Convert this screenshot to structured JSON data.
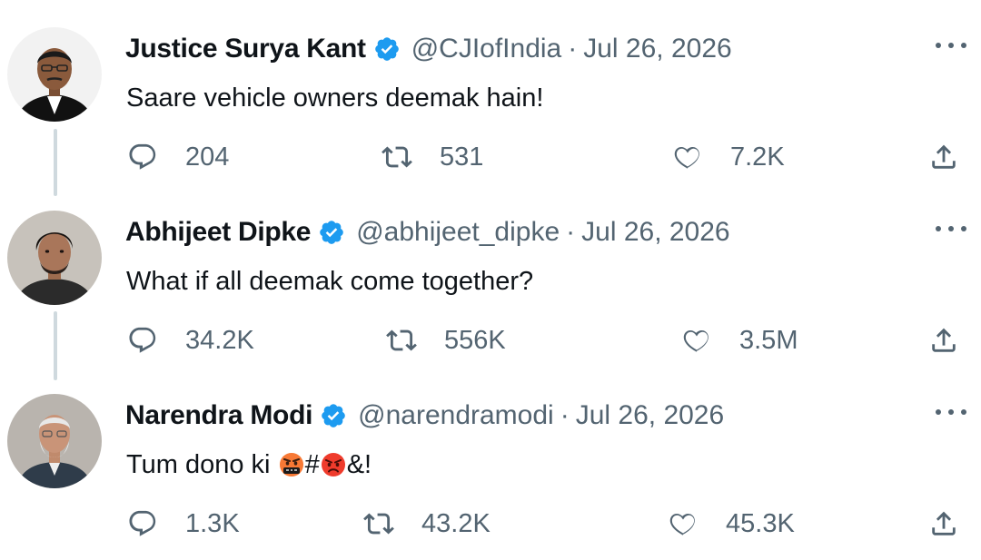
{
  "tweets": [
    {
      "display_name": "Justice Surya Kant",
      "handle": "@CJIofIndia",
      "separator": "·",
      "date": "Jul 26, 2026",
      "text": "Saare vehicle owners deemak hain!",
      "replies": "204",
      "retweets": "531",
      "likes": "7.2K"
    },
    {
      "display_name": "Abhijeet Dipke",
      "handle": "@abhijeet_dipke",
      "separator": "·",
      "date": "Jul 26, 2026",
      "text": "What if all deemak come together?",
      "replies": "34.2K",
      "retweets": "556K",
      "likes": "3.5M"
    },
    {
      "display_name": "Narendra Modi",
      "handle": "@narendramodi",
      "separator": "·",
      "date": "Jul 26, 2026",
      "text_before": "Tum dono ki ",
      "text_mid": "#",
      "text_after": "&!",
      "replies": "1.3K",
      "retweets": "43.2K",
      "likes": "45.3K"
    }
  ],
  "icons": {
    "verified_color": "#1d9bf0",
    "reply": "reply-icon",
    "retweet": "retweet-icon",
    "like": "heart-icon",
    "share": "share-icon",
    "more": "more-icon"
  }
}
